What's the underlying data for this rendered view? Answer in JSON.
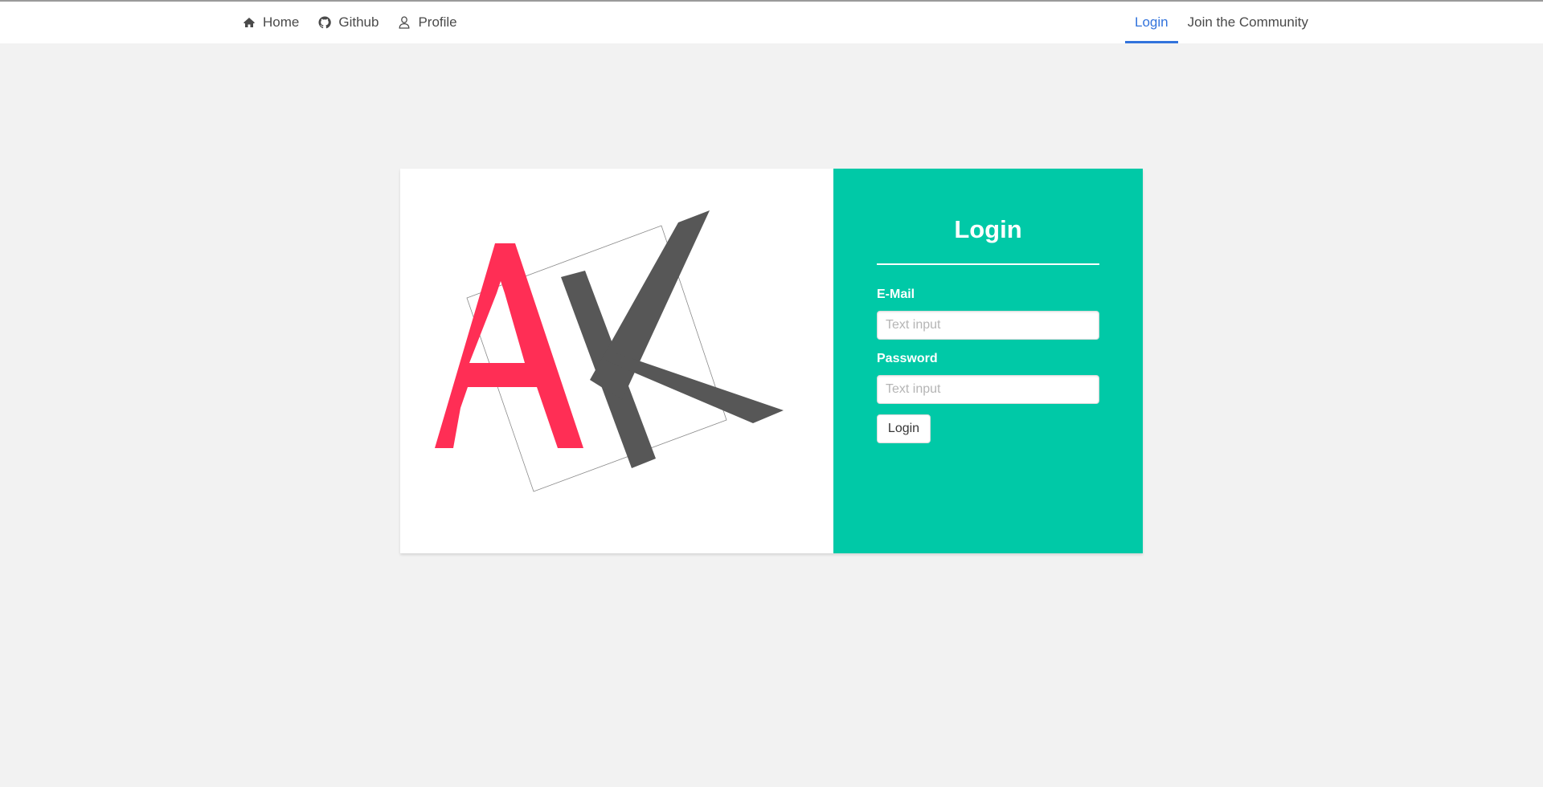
{
  "nav": {
    "left": [
      {
        "label": "Home",
        "icon": "home-icon"
      },
      {
        "label": "Github",
        "icon": "github-icon"
      },
      {
        "label": "Profile",
        "icon": "user-icon"
      }
    ],
    "right": [
      {
        "label": "Login",
        "active": true
      },
      {
        "label": "Join the Community",
        "active": false
      }
    ]
  },
  "logo": {
    "letters": "AK",
    "colors": {
      "a": "#ff2e55",
      "k": "#575757"
    }
  },
  "login": {
    "title": "Login",
    "email_label": "E-Mail",
    "email_placeholder": "Text input",
    "email_value": "",
    "password_label": "Password",
    "password_placeholder": "Text input",
    "password_value": "",
    "button_label": "Login"
  },
  "colors": {
    "accent": "#00c9a7",
    "link_active": "#3273dc",
    "background": "#f2f2f2"
  }
}
